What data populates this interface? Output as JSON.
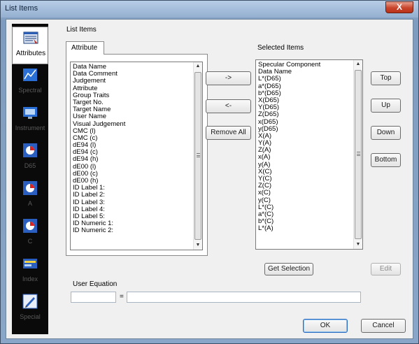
{
  "window": {
    "title": "List Items",
    "close_glyph": "X"
  },
  "sidebar": {
    "items": [
      {
        "label": "Attributes",
        "icon": "attributes-icon",
        "selected": true
      },
      {
        "label": "Spectral",
        "icon": "spectral-icon",
        "selected": false
      },
      {
        "label": "Instrument",
        "icon": "instrument-icon",
        "selected": false
      },
      {
        "label": "D65",
        "icon": "illuminant-d65-icon",
        "selected": false
      },
      {
        "label": "A",
        "icon": "illuminant-a-icon",
        "selected": false
      },
      {
        "label": "C",
        "icon": "illuminant-c-icon",
        "selected": false
      },
      {
        "label": "Index",
        "icon": "index-icon",
        "selected": false
      },
      {
        "label": "Special",
        "icon": "special-icon",
        "selected": false
      }
    ]
  },
  "main": {
    "section_label": "List Items",
    "tab_label": "Attribute",
    "selected_label": "Selected Items",
    "available_items": [
      "Data Name",
      "Data Comment",
      "Judgement",
      "Attribute",
      "Group Traits",
      "Target No.",
      "Target Name",
      "User Name",
      "Visual Judgement",
      "CMC (l)",
      "CMC (c)",
      "dE94 (l)",
      "dE94 (c)",
      "dE94 (h)",
      "dE00 (l)",
      "dE00 (c)",
      "dE00 (h)",
      "ID Label 1:",
      "ID Label 2:",
      "ID Label 3:",
      "ID Label 4:",
      "ID Label 5:",
      "ID Numeric 1:",
      "ID Numeric 2:"
    ],
    "selected_items": [
      "Specular Component",
      "Data Name",
      "L*(D65)",
      "a*(D65)",
      "b*(D65)",
      "X(D65)",
      "Y(D65)",
      "Z(D65)",
      "x(D65)",
      "y(D65)",
      "X(A)",
      "Y(A)",
      "Z(A)",
      "x(A)",
      "y(A)",
      "X(C)",
      "Y(C)",
      "Z(C)",
      "x(C)",
      "y(C)",
      "L*(C)",
      "a*(C)",
      "b*(C)",
      "L*(A)"
    ],
    "buttons": {
      "add": "->",
      "remove": "<-",
      "remove_all": "Remove All",
      "top": "Top",
      "up": "Up",
      "down": "Down",
      "bottom": "Bottom",
      "get_selection": "Get Selection",
      "edit": "Edit",
      "ok": "OK",
      "cancel": "Cancel"
    },
    "user_equation": {
      "label": "User Equation",
      "name_value": "",
      "equals": "=",
      "expression_value": ""
    }
  }
}
